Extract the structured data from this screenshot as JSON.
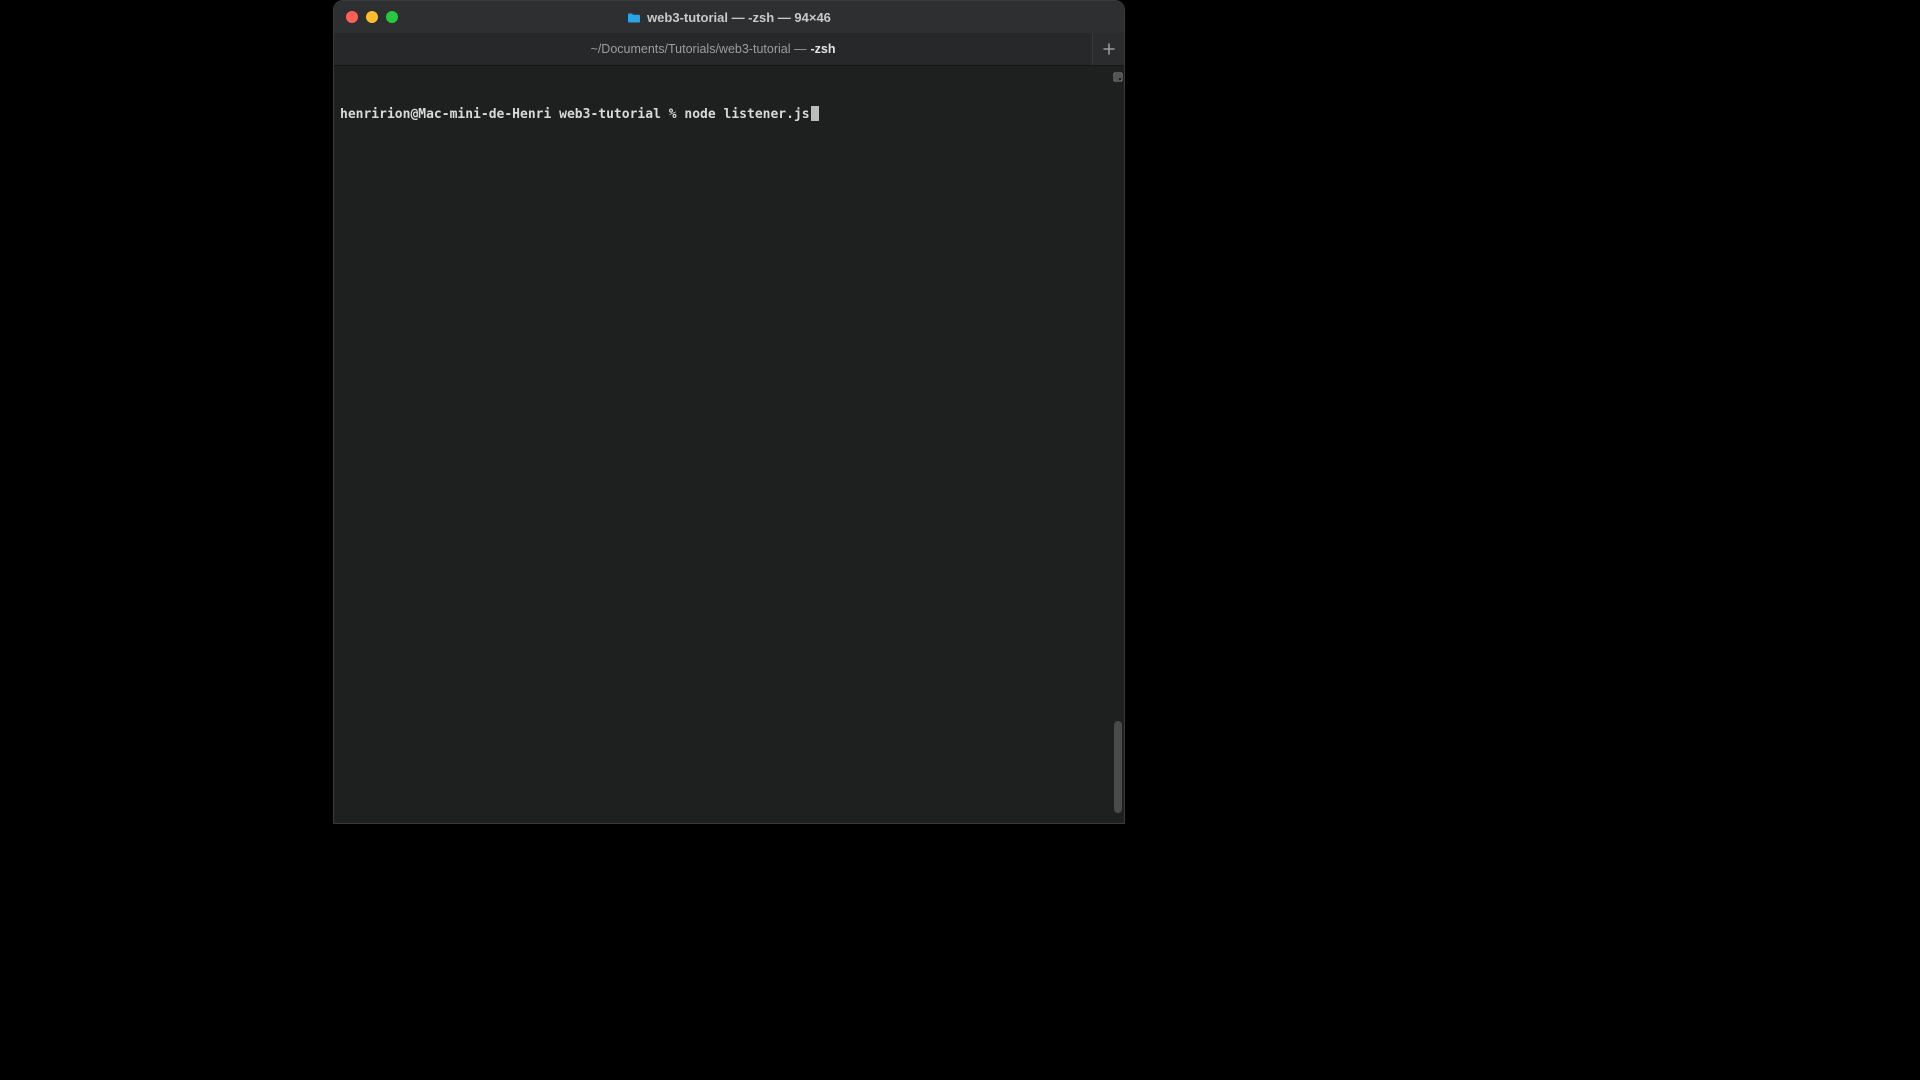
{
  "window": {
    "title": "web3-tutorial — -zsh — 94×46",
    "proxy_icon": "folder-icon",
    "traffic_colors": {
      "close": "#ff5f57",
      "minimize": "#febc2e",
      "zoom": "#28c840"
    }
  },
  "tabs": {
    "active": {
      "path": "~/Documents/Tutorials/web3-tutorial —",
      "shell": "-zsh"
    },
    "add_label": "+"
  },
  "terminal": {
    "prompt": "henririon@Mac-mini-de-Henri web3-tutorial % ",
    "command": "node listener.js"
  },
  "colors": {
    "bg": "#1e1f1f",
    "chrome": "#2e2f31",
    "text": "#d9d9d9"
  }
}
